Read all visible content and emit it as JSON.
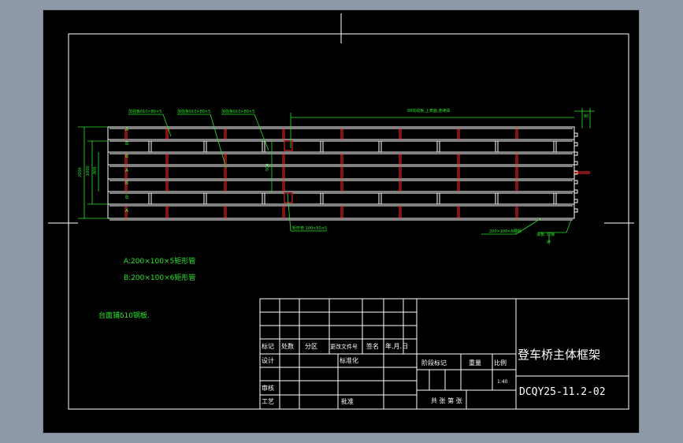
{
  "drawing": {
    "title": "登车桥主体框架",
    "drawing_number": "DCQY25-11.2-02",
    "scale": "1:40",
    "material_notes": [
      "A:200×100×5矩形管",
      "B:200×100×6矩形管"
    ],
    "surface_note": "台面铺δ10钢板.",
    "leader_labels": [
      "加强板δ10×80×5",
      "加强板δ10×80×5",
      "加强板δ10×80×5",
      "δ8花纹板,上表面,连续焊"
    ],
    "bottom_labels": [
      "矩形管 100×50×5",
      "200×100×6槽钢",
      "滚板, 焊接",
      "排"
    ],
    "row_marks": [
      "A",
      "B",
      "B",
      "A",
      "B",
      "B",
      "A"
    ],
    "dimensions": [
      "2000",
      "1000",
      "800",
      "500",
      "80"
    ]
  },
  "title_block": {
    "header_row": [
      "标记",
      "处数",
      "分区",
      "更改文件号",
      "签名",
      "年.月.日"
    ],
    "design": "设计",
    "standardize": "标准化",
    "check": "审核",
    "process": "工艺",
    "approve": "批准",
    "stage_label": "阶段标记",
    "weight_label": "重量",
    "scale_label": "比例",
    "sheets": "共  张  第  张"
  }
}
